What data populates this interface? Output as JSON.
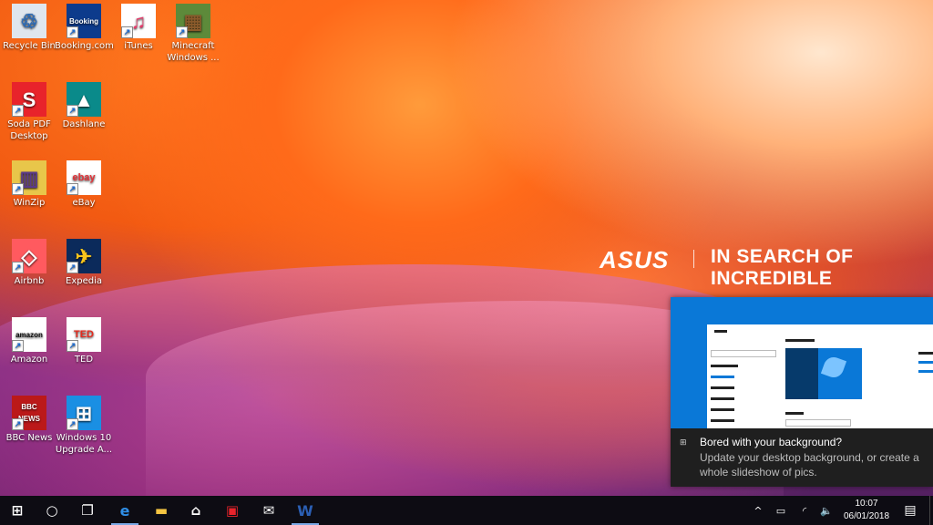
{
  "desktop": {
    "icons": [
      {
        "label": "Recycle Bin",
        "glyph": "♲",
        "bg": "#dfe6ee",
        "fg": "#2b6bb8",
        "icon": "recycle-bin-icon",
        "shortcut": false
      },
      {
        "label": "Booking.com",
        "glyph": "Booking",
        "bg": "#0d3b8c",
        "fg": "#ffffff",
        "icon": "booking-icon",
        "shortcut": true
      },
      {
        "label": "iTunes",
        "glyph": "♫",
        "bg": "#ffffff",
        "fg": "#e23a6a",
        "icon": "itunes-icon",
        "shortcut": true
      },
      {
        "label": "Minecraft Windows ...",
        "glyph": "▦",
        "bg": "#5d8a3a",
        "fg": "#8a5a2b",
        "icon": "minecraft-icon",
        "shortcut": true
      },
      {
        "label": "Soda PDF Desktop",
        "glyph": "S",
        "bg": "#e8232b",
        "fg": "#ffffff",
        "icon": "soda-pdf-icon",
        "shortcut": true
      },
      {
        "label": "Dashlane",
        "glyph": "▲",
        "bg": "#0a8a8a",
        "fg": "#ffffff",
        "icon": "dashlane-icon",
        "shortcut": true
      },
      {
        "label": "WinZip",
        "glyph": "▥",
        "bg": "#e8c64a",
        "fg": "#5a3a8a",
        "icon": "winzip-icon",
        "shortcut": true
      },
      {
        "label": "eBay",
        "glyph": "ebay",
        "bg": "#ffffff",
        "fg": "#e53238",
        "icon": "ebay-icon",
        "shortcut": true
      },
      {
        "label": "Airbnb",
        "glyph": "◇",
        "bg": "#ff5a5f",
        "fg": "#ffffff",
        "icon": "airbnb-icon",
        "shortcut": true
      },
      {
        "label": "Expedia",
        "glyph": "✈",
        "bg": "#0b2a5b",
        "fg": "#f8c51c",
        "icon": "expedia-icon",
        "shortcut": true
      },
      {
        "label": "Amazon",
        "glyph": "amazon",
        "bg": "#ffffff",
        "fg": "#111111",
        "icon": "amazon-icon",
        "shortcut": true
      },
      {
        "label": "TED",
        "glyph": "TED",
        "bg": "#ffffff",
        "fg": "#e62b1e",
        "icon": "ted-icon",
        "shortcut": true
      },
      {
        "label": "BBC News",
        "glyph": "BBC NEWS",
        "bg": "#bb1919",
        "fg": "#ffffff",
        "icon": "bbc-news-icon",
        "shortcut": true
      },
      {
        "label": "Windows 10 Upgrade A...",
        "glyph": "⊞",
        "bg": "#1a8fe3",
        "fg": "#ffffff",
        "icon": "windows-upgrade-icon",
        "shortcut": true
      }
    ]
  },
  "branding": {
    "logo": "ASUS",
    "tagline": "IN SEARCH OF INCREDIBLE"
  },
  "notification": {
    "title": "Bored with your background?",
    "body": "Update your desktop background, or create a whole slideshow of pics."
  },
  "taskbar": {
    "buttons": [
      {
        "name": "start-button",
        "glyph": "⊞",
        "color": "#ffffff",
        "active": false
      },
      {
        "name": "search-button",
        "glyph": "○",
        "color": "#ffffff",
        "active": false
      },
      {
        "name": "task-view-button",
        "glyph": "❐",
        "color": "#ffffff",
        "active": false
      },
      {
        "name": "edge-button",
        "glyph": "e",
        "color": "#2f8ee6",
        "active": true
      },
      {
        "name": "file-explorer-button",
        "glyph": "▬",
        "color": "#f5c542",
        "active": false
      },
      {
        "name": "store-button",
        "glyph": "⌂",
        "color": "#ffffff",
        "active": false
      },
      {
        "name": "gift-app-button",
        "glyph": "▣",
        "color": "#e8232b",
        "active": false
      },
      {
        "name": "mail-button",
        "glyph": "✉",
        "color": "#ffffff",
        "active": false
      },
      {
        "name": "word-button",
        "glyph": "W",
        "color": "#2b5fb4",
        "active": true
      }
    ],
    "tray": {
      "chevron": "^",
      "battery": "▭",
      "wifi": "◜",
      "volume": "🔈",
      "notifications": "▤"
    },
    "time": "10:07",
    "date": "06/01/2018"
  }
}
